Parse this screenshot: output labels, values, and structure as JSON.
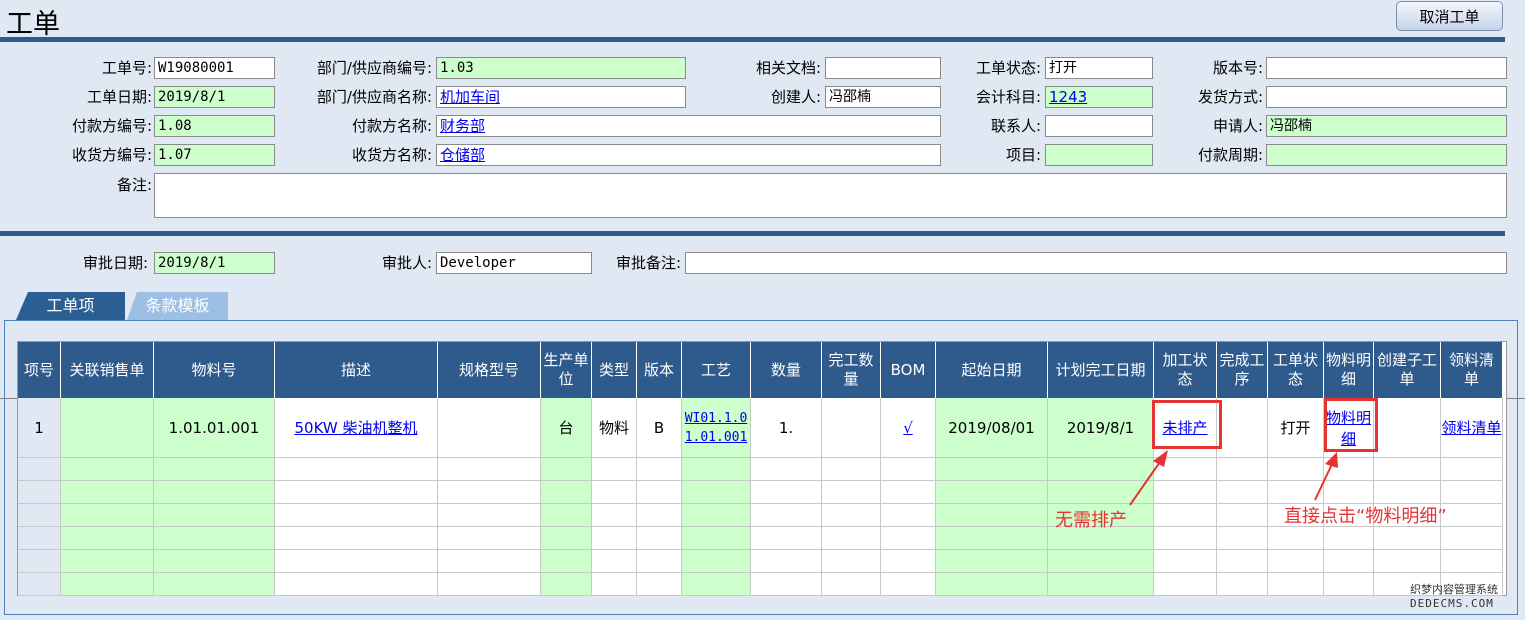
{
  "page_title": "工单",
  "cancel_button": "取消工单",
  "header": {
    "wo_no_label": "工单号:",
    "wo_no": "W19080001",
    "dept_code_label": "部门/供应商编号:",
    "dept_code": "1.03",
    "related_doc_label": "相关文档:",
    "related_doc": "",
    "wo_status_label": "工单状态:",
    "wo_status": "打开",
    "version_label": "版本号:",
    "version": "",
    "wo_date_label": "工单日期:",
    "wo_date": "2019/8/1",
    "dept_name_label": "部门/供应商名称:",
    "dept_name": "机加车间",
    "creator_label": "创建人:",
    "creator": "冯邵楠",
    "account_label": "会计科目:",
    "account": "1243",
    "ship_method_label": "发货方式:",
    "ship_method": "",
    "payer_code_label": "付款方编号:",
    "payer_code": "1.08",
    "payer_name_label": "付款方名称:",
    "payer_name": "财务部",
    "contact_label": "联系人:",
    "contact": "",
    "applicant_label": "申请人:",
    "applicant": "冯邵楠",
    "receiver_code_label": "收货方编号:",
    "receiver_code": "1.07",
    "receiver_name_label": "收货方名称:",
    "receiver_name": "仓储部",
    "project_label": "项目:",
    "project": "",
    "pay_period_label": "付款周期:",
    "pay_period": "",
    "remark_label": "备注:",
    "remark": ""
  },
  "approval": {
    "date_label": "审批日期:",
    "date": "2019/8/1",
    "approver_label": "审批人:",
    "approver": "Developer",
    "note_label": "审批备注:",
    "note": ""
  },
  "tabs": [
    "工单项",
    "条款模板"
  ],
  "grid": {
    "columns": [
      "项号",
      "关联销售单",
      "物料号",
      "描述",
      "规格型号",
      "生产单位",
      "类型",
      "版本",
      "工艺",
      "数量",
      "完工数量",
      "BOM",
      "起始日期",
      "计划完工日期",
      "加工状态",
      "完成工序",
      "工单状态",
      "物料明细",
      "创建子工单",
      "领料清单"
    ],
    "row": {
      "item_no": "1",
      "sales_order": "",
      "material_no": "1.01.01.001",
      "description": "50KW 柴油机整机",
      "spec": "",
      "unit": "台",
      "type": "物料",
      "version": "B",
      "process": "WI01.1.01.01.001",
      "qty": "1.",
      "done_qty": "",
      "bom": "√",
      "start_date": "2019/08/01",
      "plan_date": "2019/8/1",
      "proc_status": "未排产",
      "done_step": "",
      "wo_status": "打开",
      "material_detail": "物料明细",
      "sub_wo": "",
      "pick_list": "领料清单"
    }
  },
  "annotations": {
    "no_schedule": "无需排产",
    "click_detail": "直接点击“物料明细”"
  },
  "watermark": {
    "line1": "织梦内容管理系统",
    "line2": "DEDECMS.COM"
  },
  "colors": {
    "header_blue": "#2f5a8c",
    "field_green": "#ccffcc",
    "annotation_red": "#e53333"
  }
}
